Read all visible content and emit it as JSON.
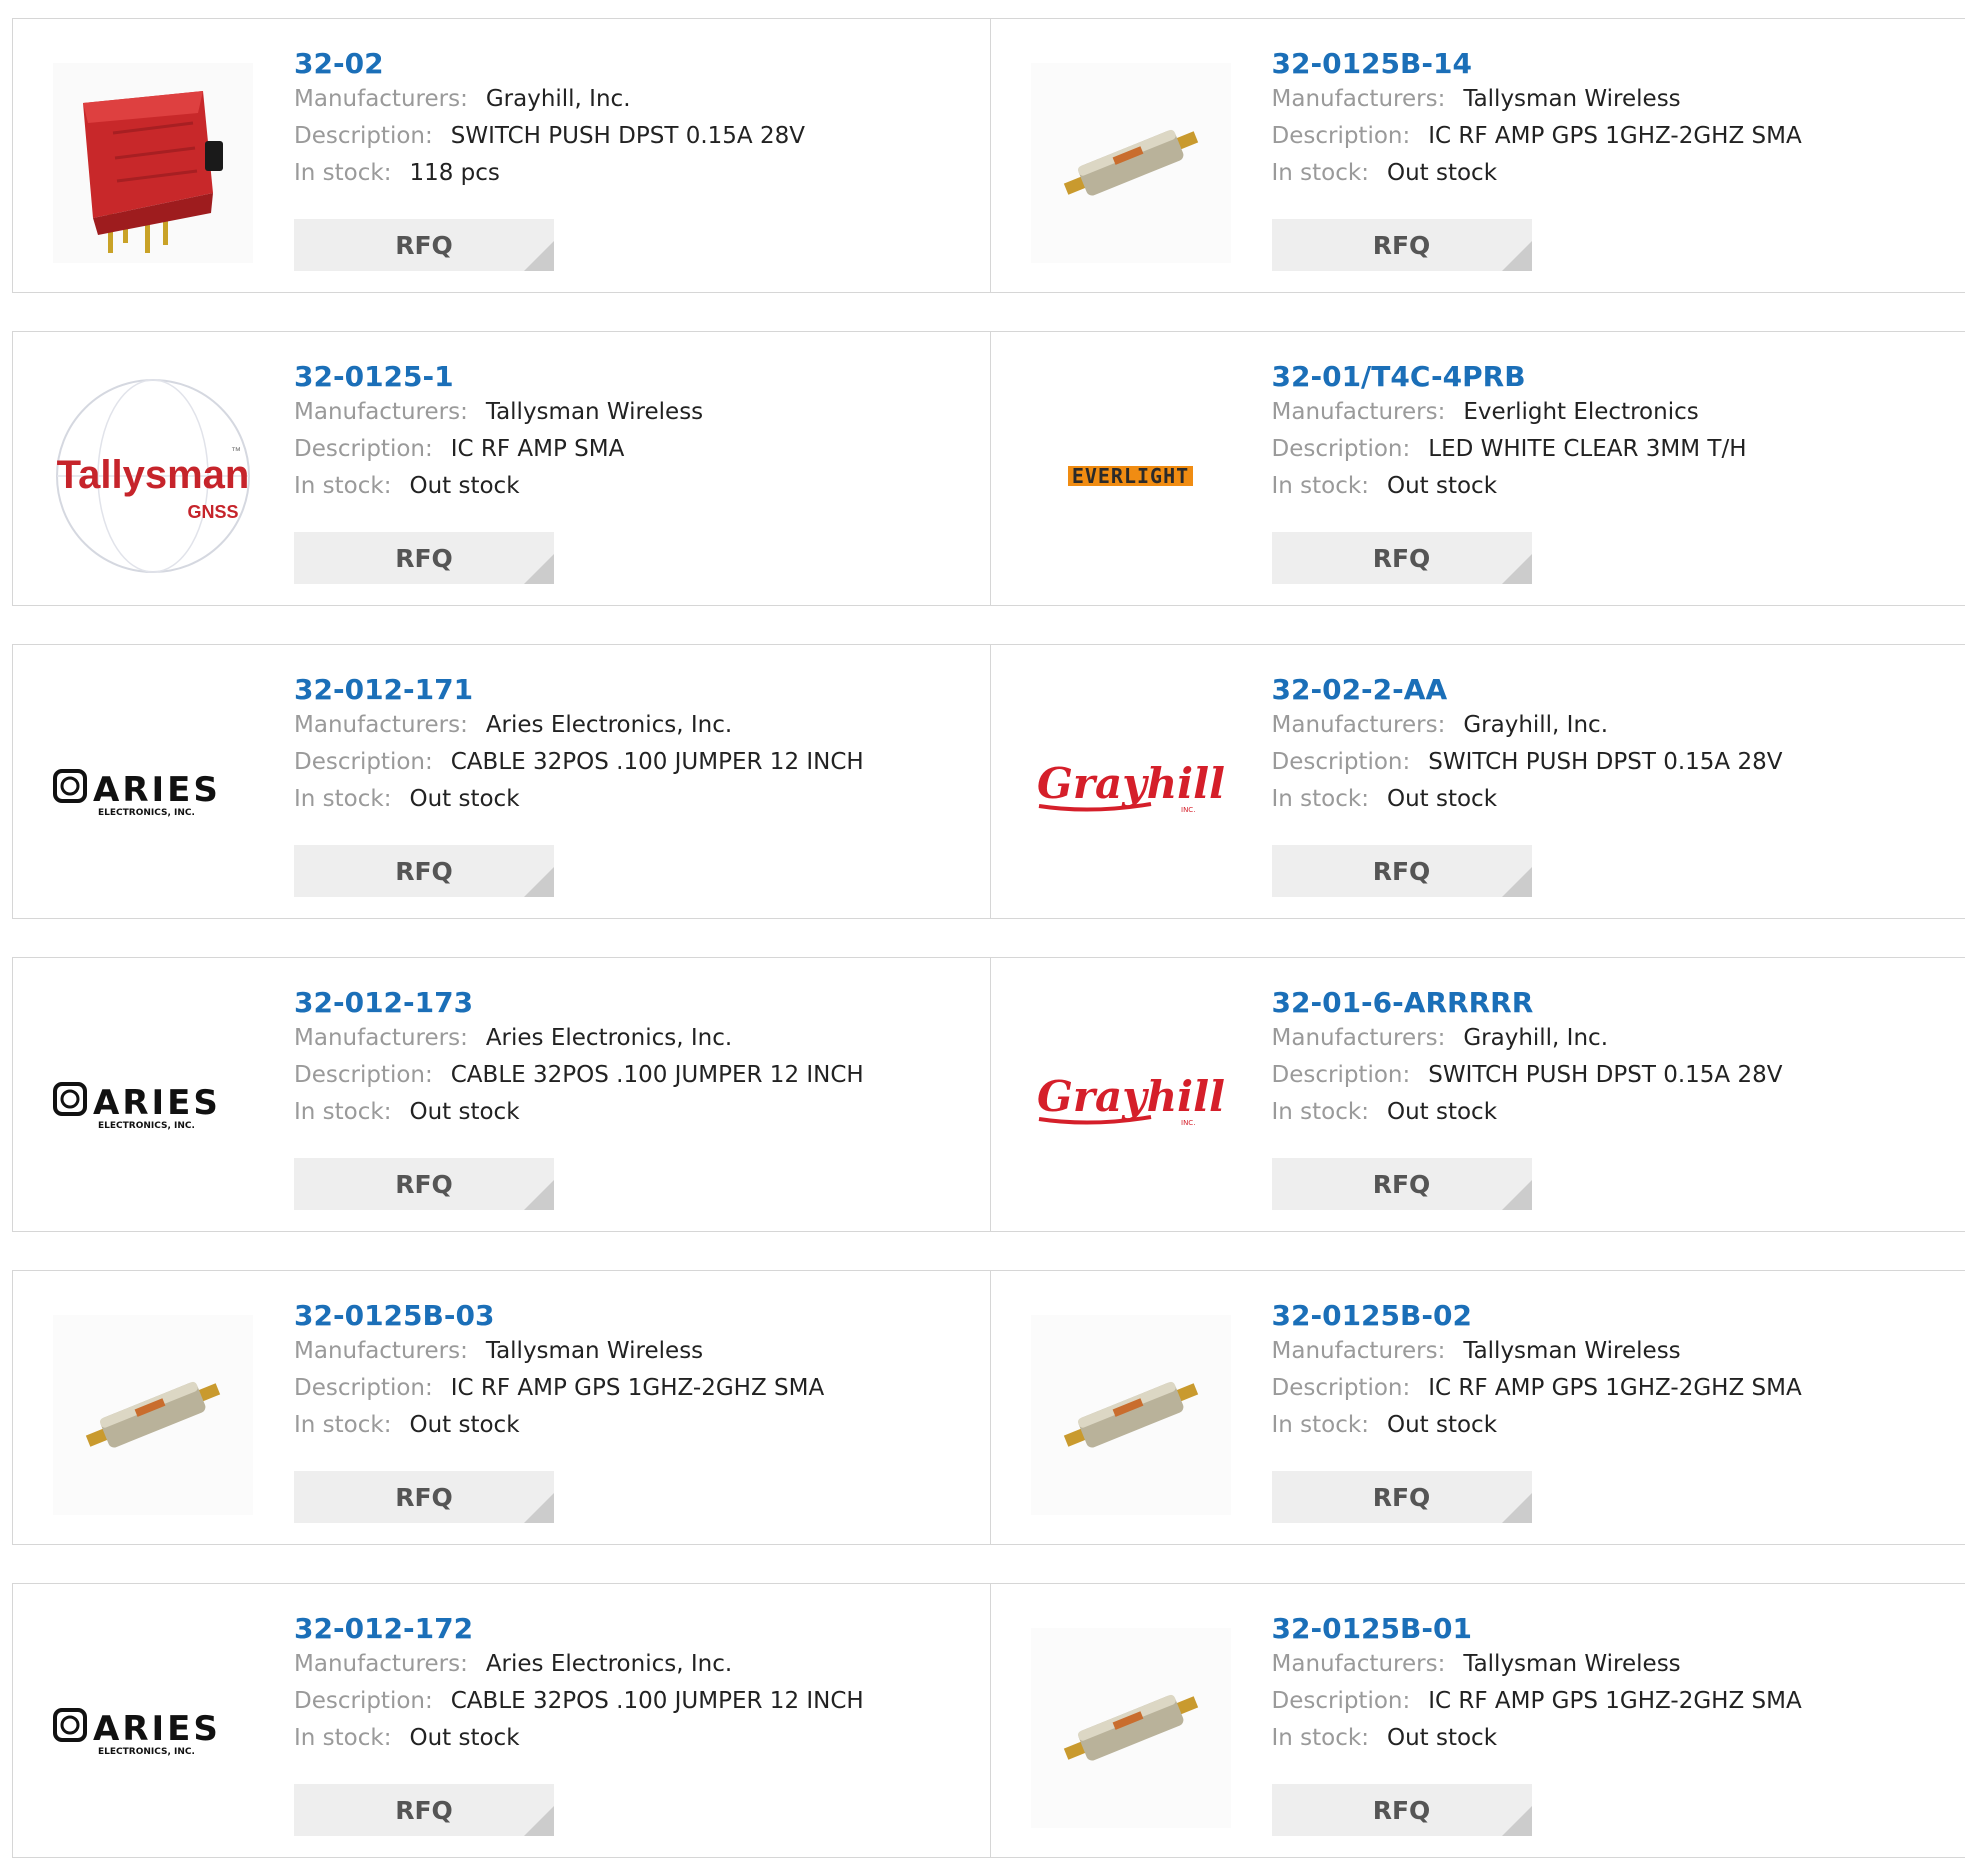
{
  "labels": {
    "manufacturers": "Manufacturers:",
    "description": "Description:",
    "stock": "In stock:",
    "rfq": "RFQ"
  },
  "products": [
    [
      {
        "pn": "32-02",
        "manufacturer": "Grayhill, Inc.",
        "description": "SWITCH PUSH DPST 0.15A 28V",
        "stock": "118 pcs",
        "image": "red-switch"
      },
      {
        "pn": "32-0125B-14",
        "manufacturer": "Tallysman Wireless",
        "description": "IC RF AMP GPS 1GHZ-2GHZ SMA",
        "stock": "Out stock",
        "image": "rf-amplifier"
      }
    ],
    [
      {
        "pn": "32-0125-1",
        "manufacturer": "Tallysman Wireless",
        "description": "IC RF AMP SMA",
        "stock": "Out stock",
        "image": "tallysman-logo",
        "logo_text": "Tallysman",
        "logo_sub": "GNSS",
        "logo_tm": "™"
      },
      {
        "pn": "32-01/T4C-4PRB",
        "manufacturer": "Everlight Electronics",
        "description": "LED WHITE CLEAR 3MM T/H",
        "stock": "Out stock",
        "image": "everlight-logo",
        "logo_text": "EVERLIGHT"
      }
    ],
    [
      {
        "pn": "32-012-171",
        "manufacturer": "Aries Electronics, Inc.",
        "description": "CABLE 32POS .100 JUMPER 12 INCH",
        "stock": "Out stock",
        "image": "aries-logo",
        "logo_text": "ARIES",
        "logo_sub": "ELECTRONICS, INC."
      },
      {
        "pn": "32-02-2-AA",
        "manufacturer": "Grayhill, Inc.",
        "description": "SWITCH PUSH DPST 0.15A 28V",
        "stock": "Out stock",
        "image": "grayhill-logo",
        "logo_text": "Grayhill",
        "logo_sub": "INC."
      }
    ],
    [
      {
        "pn": "32-012-173",
        "manufacturer": "Aries Electronics, Inc.",
        "description": "CABLE 32POS .100 JUMPER 12 INCH",
        "stock": "Out stock",
        "image": "aries-logo",
        "logo_text": "ARIES",
        "logo_sub": "ELECTRONICS, INC."
      },
      {
        "pn": "32-01-6-ARRRRR",
        "manufacturer": "Grayhill, Inc.",
        "description": "SWITCH PUSH DPST 0.15A 28V",
        "stock": "Out stock",
        "image": "grayhill-logo",
        "logo_text": "Grayhill",
        "logo_sub": "INC."
      }
    ],
    [
      {
        "pn": "32-0125B-03",
        "manufacturer": "Tallysman Wireless",
        "description": "IC RF AMP GPS 1GHZ-2GHZ SMA",
        "stock": "Out stock",
        "image": "rf-amplifier"
      },
      {
        "pn": "32-0125B-02",
        "manufacturer": "Tallysman Wireless",
        "description": "IC RF AMP GPS 1GHZ-2GHZ SMA",
        "stock": "Out stock",
        "image": "rf-amplifier"
      }
    ],
    [
      {
        "pn": "32-012-172",
        "manufacturer": "Aries Electronics, Inc.",
        "description": "CABLE 32POS .100 JUMPER 12 INCH",
        "stock": "Out stock",
        "image": "aries-logo",
        "logo_text": "ARIES",
        "logo_sub": "ELECTRONICS, INC."
      },
      {
        "pn": "32-0125B-01",
        "manufacturer": "Tallysman Wireless",
        "description": "IC RF AMP GPS 1GHZ-2GHZ SMA",
        "stock": "Out stock",
        "image": "rf-amplifier"
      }
    ]
  ]
}
